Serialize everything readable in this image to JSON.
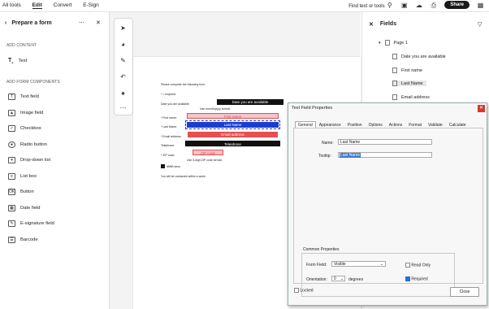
{
  "topbar": {
    "menu": [
      "All tools",
      "Edit",
      "Convert",
      "E-Sign"
    ],
    "active_menu": "Edit",
    "search_label": "Find text or tools",
    "share_label": "Share"
  },
  "left_panel": {
    "title": "Prepare a form",
    "section_add_content": "ADD CONTENT",
    "text_item": "Text",
    "section_components": "ADD FORM COMPONENTS",
    "components": [
      "Text field",
      "Image field",
      "Checkbox",
      "Radio button",
      "Drop-down list",
      "List box",
      "Button",
      "Date field",
      "E-signature field",
      "Barcode"
    ]
  },
  "document": {
    "intro": "Please complete the following form.",
    "required_note": "* = required",
    "date_label": "Date you are available",
    "date_field": "Date you are available",
    "date_format": "Use mm/dd/yyyy format",
    "first_name_label": "* First name:",
    "first_name_field": "First name",
    "last_name_label": "* Last Name:",
    "last_name_field": "Last Name",
    "email_label": "* Email address:",
    "email_field": "Email address",
    "telephone_label": "Telephone:",
    "telephone_field": "Telephone",
    "zip_label": "* ZIP code:",
    "zip_field": "ZIP code",
    "zip_format": "Use 5-digit ZIP code format.",
    "remark": "MWB sess",
    "footer": "You will be contacted within a week."
  },
  "right_panel": {
    "title": "Fields",
    "page_node": "Page 1",
    "fields": [
      "Date you are available",
      "First name",
      "Last Name",
      "Email address"
    ]
  },
  "dialog": {
    "title": "Text Field Properties",
    "tabs": [
      "General",
      "Appearance",
      "Position",
      "Options",
      "Actions",
      "Format",
      "Validate",
      "Calculate"
    ],
    "name_label": "Name:",
    "name_value": "Last Name",
    "tooltip_label": "Tooltip:",
    "tooltip_value": "Last Name",
    "common_title": "Common Properties",
    "form_field_label": "Form Field:",
    "form_field_value": "Visible",
    "orientation_label": "Orientation:",
    "orientation_value": "0",
    "orientation_unit": "degrees",
    "read_only_label": "Read Only",
    "required_label": "Required",
    "locked_label": "Locked",
    "close_label": "Close"
  },
  "colors": {
    "field_blue": "#1a3ecc",
    "field_red": "#e84e4e",
    "field_pink": "#f2c6cc",
    "checkbox_blue": "#2a6fd6"
  }
}
